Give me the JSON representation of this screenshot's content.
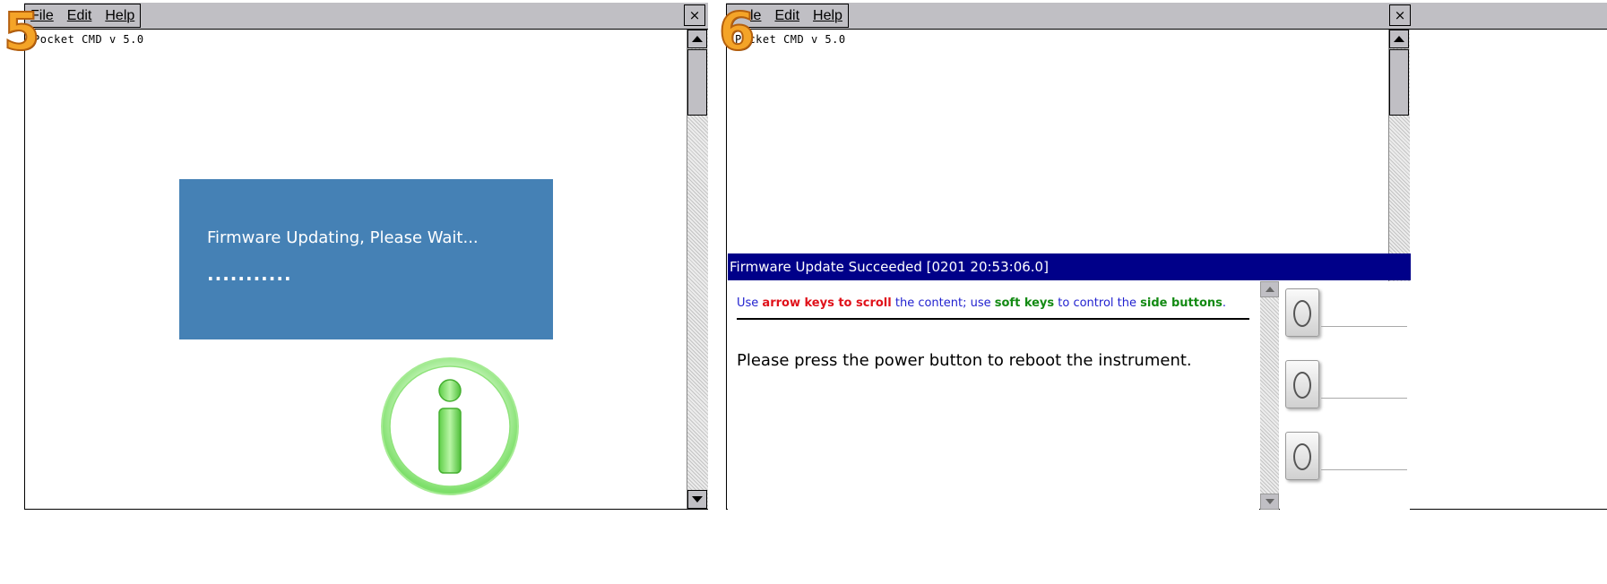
{
  "step_badges": {
    "left": "5",
    "right": "6"
  },
  "menu": {
    "file": "File",
    "edit": "Edit",
    "help": "Help",
    "file_partial": "le"
  },
  "close_glyph": "×",
  "console": {
    "line": "Pocket CMD v 5.0",
    "line_partial": "P  cket CMD v 5.0"
  },
  "updating": {
    "message": "Firmware Updating, Please Wait...",
    "dots": "..........."
  },
  "dialog": {
    "title": "Firmware Update Succeeded [0201 20:53:06.0]",
    "hint": {
      "p1": "Use ",
      "p2": "arrow keys to scroll",
      "p3": " the content; use ",
      "p4": "soft keys",
      "p5": " to control the ",
      "p6": "side buttons",
      "p7": "."
    },
    "message": "Please press the power button to reboot the instrument."
  },
  "colors": {
    "updating_panel": "#4581b5",
    "dialog_title_bar": "#000089",
    "hint_blue": "#1f1fcf",
    "hint_red": "#e0111a",
    "hint_green": "#138a13",
    "badge_orange": "#f4a428",
    "info_green": "#7ee06e"
  },
  "icons": [
    "close-icon",
    "scroll-up-arrow-icon",
    "scroll-down-arrow-icon",
    "info-icon",
    "softkey-button-icon"
  ]
}
